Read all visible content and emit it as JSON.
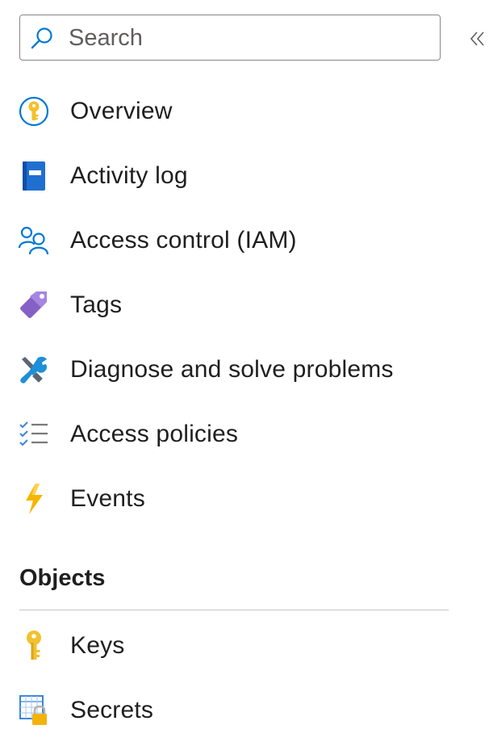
{
  "search": {
    "placeholder": "Search",
    "value": ""
  },
  "collapse": {
    "glyph": "«"
  },
  "nav": {
    "items": [
      {
        "label": "Overview",
        "icon": "key-overview-icon"
      },
      {
        "label": "Activity log",
        "icon": "activity-log-icon"
      },
      {
        "label": "Access control (IAM)",
        "icon": "people-icon"
      },
      {
        "label": "Tags",
        "icon": "tag-icon"
      },
      {
        "label": "Diagnose and solve problems",
        "icon": "wrench-icon"
      },
      {
        "label": "Access policies",
        "icon": "checklist-icon"
      },
      {
        "label": "Events",
        "icon": "lightning-icon"
      }
    ]
  },
  "objects": {
    "title": "Objects",
    "items": [
      {
        "label": "Keys",
        "icon": "key-icon"
      },
      {
        "label": "Secrets",
        "icon": "secret-icon"
      }
    ]
  },
  "colors": {
    "accent_blue": "#0078d4",
    "key_yellow": "#f2c12e",
    "tag_purple": "#8661c5",
    "border": "#8a8886",
    "divider": "#c8c6c4"
  }
}
